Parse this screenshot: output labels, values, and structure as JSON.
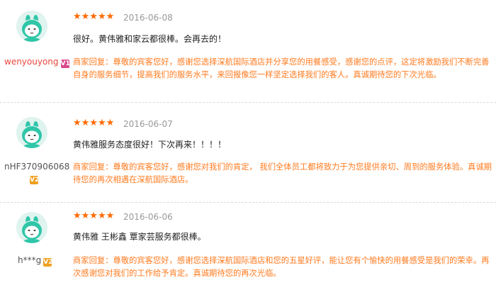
{
  "colors": {
    "stars": "#ff6a00",
    "reply_text": "#ff7a1e",
    "username_1": "#e8453c",
    "username_default": "#555555",
    "badge_1": "#d9488a",
    "badge_default": "#f0a020"
  },
  "reviews": [
    {
      "username": "wenyouyong",
      "badge_text": "V1",
      "stars": "★★★★★",
      "rating": 5,
      "date": "2016-06-08",
      "comment": "很好。黄伟雅和家云都很棒。会再去的！",
      "reply": "商家回复：尊敬的宾客您好，感谢您选择深航国际酒店并分享您的用餐感受，感谢您的点评，这定将激励我们不断完善自身的服务细节，提高我们的服务水平，来回报像您一样坚定选择我们的客人。真诚期待您的下次光临。"
    },
    {
      "username": "nHF370906068",
      "badge_text": "V2",
      "stars": "★★★★★",
      "rating": 5,
      "date": "2016-06-07",
      "comment": "黄伟雅服务态度很好！下次再来！！！！",
      "reply": "商家回复：尊敬的宾客您好，感谢您对我们的肯定， 我们全体员工都将致力于为您提供亲切、周到的服务体验。真诚期待您的再次相遇在深航国际酒店。"
    },
    {
      "username": "h***g",
      "badge_text": "V2",
      "stars": "★★★★★",
      "rating": 5,
      "date": "2016-06-06",
      "comment": "黄伟雅 王彬鑫 覃家芸服务都很棒。",
      "reply": "商家回复：尊敬的宾客您好，感谢您选择深航国际酒店和您的五星好评，能让您有个愉快的用餐感受是我们的荣幸。再次感谢您对我们的工作给予肯定。真诚期待您的再次光临。"
    }
  ]
}
